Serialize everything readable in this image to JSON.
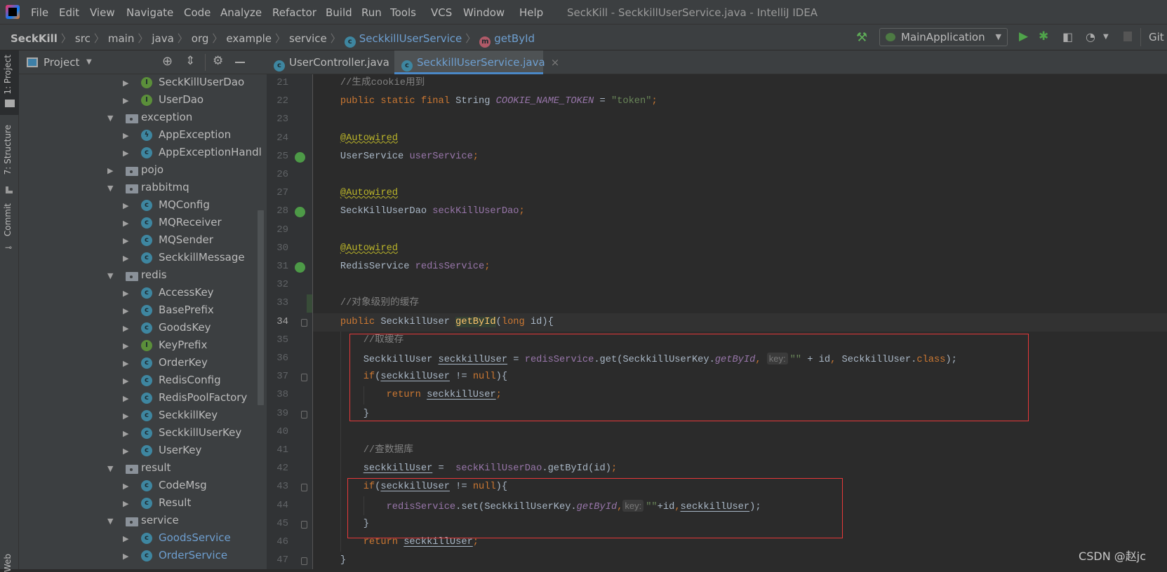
{
  "app": {
    "title": "SeckKill - SeckkillUserService.java - IntelliJ IDEA",
    "logo": "intellij-logo"
  },
  "menu": [
    "File",
    "Edit",
    "View",
    "Navigate",
    "Code",
    "Analyze",
    "Refactor",
    "Build",
    "Run",
    "Tools",
    "VCS",
    "Window",
    "Help"
  ],
  "breadcrumb": [
    {
      "label": "SeckKill",
      "bold": true
    },
    {
      "label": "src"
    },
    {
      "label": "main"
    },
    {
      "label": "java"
    },
    {
      "label": "org"
    },
    {
      "label": "example"
    },
    {
      "label": "service"
    },
    {
      "label": "SeckkillUserService",
      "icon": "class-icon",
      "color": "#6e9fd0"
    },
    {
      "label": "getById",
      "icon": "method-icon",
      "color": "#6e9fd0"
    }
  ],
  "toolbar": {
    "run_config": "MainApplication",
    "git": "Git"
  },
  "left_strip": {
    "project": "1: Project",
    "structure": "7: Structure",
    "commit": "Commit",
    "web": "Web"
  },
  "project_panel": {
    "title": "Project"
  },
  "tree": [
    {
      "label": "SeckKillUserDao",
      "kind": "interface",
      "level": 2
    },
    {
      "label": "UserDao",
      "kind": "interface",
      "level": 2
    },
    {
      "label": "exception",
      "kind": "folder",
      "level": 1,
      "expanded": true
    },
    {
      "label": "AppException",
      "kind": "exception",
      "level": 2
    },
    {
      "label": "AppExceptionHandl",
      "kind": "class",
      "level": 2
    },
    {
      "label": "pojo",
      "kind": "folder",
      "level": 1,
      "expanded": false
    },
    {
      "label": "rabbitmq",
      "kind": "folder",
      "level": 1,
      "expanded": true
    },
    {
      "label": "MQConfig",
      "kind": "class",
      "level": 2
    },
    {
      "label": "MQReceiver",
      "kind": "class",
      "level": 2
    },
    {
      "label": "MQSender",
      "kind": "class",
      "level": 2
    },
    {
      "label": "SeckkillMessage",
      "kind": "class",
      "level": 2
    },
    {
      "label": "redis",
      "kind": "folder",
      "level": 1,
      "expanded": true
    },
    {
      "label": "AccessKey",
      "kind": "class",
      "level": 2
    },
    {
      "label": "BasePrefix",
      "kind": "abstract",
      "level": 2
    },
    {
      "label": "GoodsKey",
      "kind": "class",
      "level": 2
    },
    {
      "label": "KeyPrefix",
      "kind": "interface",
      "level": 2
    },
    {
      "label": "OrderKey",
      "kind": "class",
      "level": 2
    },
    {
      "label": "RedisConfig",
      "kind": "class",
      "level": 2
    },
    {
      "label": "RedisPoolFactory",
      "kind": "class",
      "level": 2
    },
    {
      "label": "SeckkillKey",
      "kind": "class",
      "level": 2
    },
    {
      "label": "SeckkillUserKey",
      "kind": "class",
      "level": 2
    },
    {
      "label": "UserKey",
      "kind": "class",
      "level": 2
    },
    {
      "label": "result",
      "kind": "folder",
      "level": 1,
      "expanded": true
    },
    {
      "label": "CodeMsg",
      "kind": "class",
      "level": 2
    },
    {
      "label": "Result",
      "kind": "class",
      "level": 2
    },
    {
      "label": "service",
      "kind": "folder",
      "level": 1,
      "expanded": true
    },
    {
      "label": "GoodsService",
      "kind": "class",
      "level": 2,
      "modified": true
    },
    {
      "label": "OrderService",
      "kind": "class",
      "level": 2,
      "modified": true
    }
  ],
  "tabs": [
    {
      "label": "UserController.java",
      "active": false
    },
    {
      "label": "SeckkillUserService.java",
      "active": true
    }
  ],
  "colors": {
    "accent": "#4a88c7",
    "highlight_box": "#e8393a",
    "modified_file": "#6e9fd0"
  },
  "editor": {
    "current_line": 34,
    "bean_lines": [
      25,
      28,
      31
    ],
    "fold_lines": [
      34,
      37,
      39,
      43,
      45,
      47
    ],
    "lines": [
      {
        "n": 21,
        "tokens": [
          [
            "    ",
            ""
          ],
          [
            "//生成cookie用到",
            "cm"
          ]
        ]
      },
      {
        "n": 22,
        "tokens": [
          [
            "    ",
            ""
          ],
          [
            "public static final ",
            "kw"
          ],
          [
            "String ",
            ""
          ],
          [
            "COOKIE_NAME_TOKEN",
            "fi"
          ],
          [
            " = ",
            ""
          ],
          [
            "\"token\"",
            "st"
          ],
          [
            ";",
            "kw"
          ]
        ]
      },
      {
        "n": 23,
        "tokens": []
      },
      {
        "n": 24,
        "tokens": [
          [
            "    ",
            ""
          ],
          [
            "@Autowired",
            "an"
          ]
        ]
      },
      {
        "n": 25,
        "tokens": [
          [
            "    ",
            ""
          ],
          [
            "UserService ",
            ""
          ],
          [
            "userService",
            "fd"
          ],
          [
            ";",
            "kw"
          ]
        ]
      },
      {
        "n": 26,
        "tokens": []
      },
      {
        "n": 27,
        "tokens": [
          [
            "    ",
            ""
          ],
          [
            "@Autowired",
            "an"
          ]
        ]
      },
      {
        "n": 28,
        "tokens": [
          [
            "    ",
            ""
          ],
          [
            "SeckKillUserDao ",
            ""
          ],
          [
            "seckKillUserDao",
            "fd"
          ],
          [
            ";",
            "kw"
          ]
        ]
      },
      {
        "n": 29,
        "tokens": []
      },
      {
        "n": 30,
        "tokens": [
          [
            "    ",
            ""
          ],
          [
            "@Autowired",
            "an"
          ]
        ]
      },
      {
        "n": 31,
        "tokens": [
          [
            "    ",
            ""
          ],
          [
            "RedisService ",
            ""
          ],
          [
            "redisService",
            "fd"
          ],
          [
            ";",
            "kw"
          ]
        ]
      },
      {
        "n": 32,
        "tokens": []
      },
      {
        "n": 33,
        "tokens": [
          [
            "    ",
            ""
          ],
          [
            "//对象级别的缓存",
            "cm"
          ]
        ]
      },
      {
        "n": 34,
        "tokens": [
          [
            "    ",
            ""
          ],
          [
            "public ",
            "kw"
          ],
          [
            "SeckkillUser ",
            ""
          ],
          [
            "getById",
            "md"
          ],
          [
            "(",
            ""
          ],
          [
            "long ",
            "kw"
          ],
          [
            "id){",
            ""
          ]
        ]
      },
      {
        "n": 35,
        "tokens": [
          [
            "        ",
            ""
          ],
          [
            "//取缓存",
            "cm"
          ]
        ]
      },
      {
        "n": 36,
        "tokens": [
          [
            "        ",
            ""
          ],
          [
            "SeckkillUser ",
            ""
          ],
          [
            "seckkillUser",
            "ul"
          ],
          [
            " = ",
            ""
          ],
          [
            "redisService",
            "fd"
          ],
          [
            ".get(SeckkillUserKey.",
            ""
          ],
          [
            "getById",
            "it"
          ],
          [
            ", ",
            "kw"
          ],
          [
            "key:",
            "hint"
          ],
          [
            "\"\"",
            "st"
          ],
          [
            " + id",
            ""
          ],
          [
            ", ",
            "kw"
          ],
          [
            "SeckkillUser.",
            ""
          ],
          [
            "class",
            "kw"
          ],
          [
            ");",
            ""
          ]
        ]
      },
      {
        "n": 37,
        "tokens": [
          [
            "        ",
            ""
          ],
          [
            "if",
            "kw"
          ],
          [
            "(",
            ""
          ],
          [
            "seckkillUser",
            "ul"
          ],
          [
            " != ",
            ""
          ],
          [
            "null",
            "kw"
          ],
          [
            "){",
            ""
          ]
        ]
      },
      {
        "n": 38,
        "tokens": [
          [
            "            ",
            ""
          ],
          [
            "return ",
            "kw"
          ],
          [
            "seckkillUser",
            "ul"
          ],
          [
            ";",
            "kw"
          ]
        ]
      },
      {
        "n": 39,
        "tokens": [
          [
            "        }",
            ""
          ]
        ]
      },
      {
        "n": 40,
        "tokens": []
      },
      {
        "n": 41,
        "tokens": [
          [
            "        ",
            ""
          ],
          [
            "//查数据库",
            "cm"
          ]
        ]
      },
      {
        "n": 42,
        "tokens": [
          [
            "        ",
            ""
          ],
          [
            "seckkillUser",
            "ul"
          ],
          [
            " =  ",
            ""
          ],
          [
            "seckKillUserDao",
            "fd"
          ],
          [
            ".getById(id)",
            ""
          ],
          [
            ";",
            "kw"
          ]
        ]
      },
      {
        "n": 43,
        "tokens": [
          [
            "        ",
            ""
          ],
          [
            "if",
            "kw"
          ],
          [
            "(",
            ""
          ],
          [
            "seckkillUser",
            "ul"
          ],
          [
            " != ",
            ""
          ],
          [
            "null",
            "kw"
          ],
          [
            "){",
            ""
          ]
        ]
      },
      {
        "n": 44,
        "tokens": [
          [
            "            ",
            ""
          ],
          [
            "redisService",
            "fd"
          ],
          [
            ".set(SeckkillUserKey.",
            ""
          ],
          [
            "getById",
            "it"
          ],
          [
            ",",
            "kw"
          ],
          [
            "key:",
            "hint"
          ],
          [
            "\"\"",
            "st"
          ],
          [
            "+id",
            ""
          ],
          [
            ",",
            "kw"
          ],
          [
            "seckkillUser",
            "ul"
          ],
          [
            ");",
            ""
          ]
        ]
      },
      {
        "n": 45,
        "tokens": [
          [
            "        }",
            ""
          ]
        ]
      },
      {
        "n": 46,
        "tokens": [
          [
            "        ",
            ""
          ],
          [
            "return ",
            "kw"
          ],
          [
            "seckkillUser",
            "ul"
          ],
          [
            ";",
            "kw"
          ]
        ]
      },
      {
        "n": 47,
        "tokens": [
          [
            "    }",
            ""
          ]
        ]
      }
    ]
  },
  "watermark": "CSDN @赵jc"
}
